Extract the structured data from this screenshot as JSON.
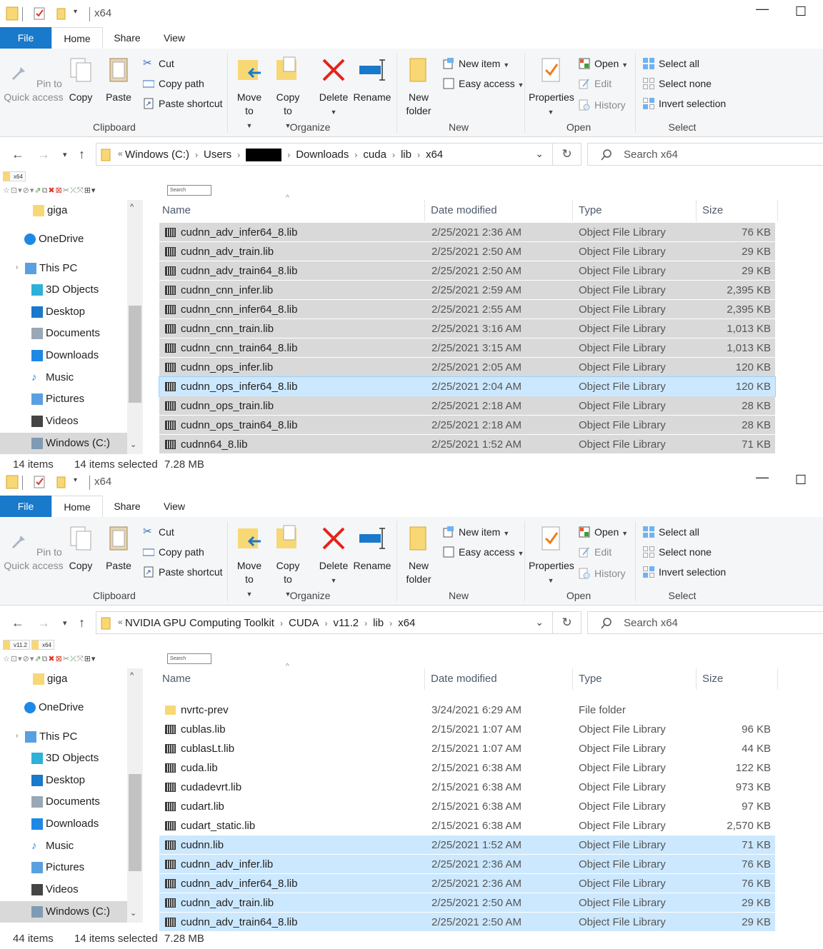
{
  "windows": [
    {
      "title": "x64",
      "tabs": [
        "File",
        "Home",
        "Share",
        "View"
      ],
      "ribbon": {
        "clipboard": {
          "label": "Clipboard",
          "pin": "Pin to Quick access",
          "copy": "Copy",
          "paste": "Paste",
          "cut": "Cut",
          "copy_path": "Copy path",
          "paste_shortcut": "Paste shortcut"
        },
        "organize": {
          "label": "Organize",
          "move_to": "Move to",
          "copy_to": "Copy to",
          "delete": "Delete",
          "rename": "Rename"
        },
        "new": {
          "label": "New",
          "new_folder": "New folder",
          "new_item": "New item",
          "easy_access": "Easy access"
        },
        "open": {
          "label": "Open",
          "properties": "Properties",
          "open": "Open",
          "edit": "Edit",
          "history": "History"
        },
        "select": {
          "label": "Select",
          "select_all": "Select all",
          "select_none": "Select none",
          "invert": "Invert selection"
        }
      },
      "address": {
        "prefix": "«",
        "crumbs": [
          "Windows (C:)",
          "Users",
          "",
          "Downloads",
          "cuda",
          "lib",
          "x64"
        ],
        "redacted_index": 2
      },
      "search_placeholder": "Search x64",
      "mini_tabs": [
        "x64"
      ],
      "mini_search": "Search",
      "nav": [
        "giga",
        "OneDrive",
        "This PC",
        "3D Objects",
        "Desktop",
        "Documents",
        "Downloads",
        "Music",
        "Pictures",
        "Videos",
        "Windows (C:)"
      ],
      "columns": [
        "Name",
        "Date modified",
        "Type",
        "Size"
      ],
      "files": [
        {
          "name": "cudnn_adv_infer64_8.lib",
          "date": "2/25/2021 2:36 AM",
          "type": "Object File Library",
          "size": "76 KB",
          "state": "gray"
        },
        {
          "name": "cudnn_adv_train.lib",
          "date": "2/25/2021 2:50 AM",
          "type": "Object File Library",
          "size": "29 KB",
          "state": "gray"
        },
        {
          "name": "cudnn_adv_train64_8.lib",
          "date": "2/25/2021 2:50 AM",
          "type": "Object File Library",
          "size": "29 KB",
          "state": "gray"
        },
        {
          "name": "cudnn_cnn_infer.lib",
          "date": "2/25/2021 2:59 AM",
          "type": "Object File Library",
          "size": "2,395 KB",
          "state": "gray"
        },
        {
          "name": "cudnn_cnn_infer64_8.lib",
          "date": "2/25/2021 2:55 AM",
          "type": "Object File Library",
          "size": "2,395 KB",
          "state": "gray"
        },
        {
          "name": "cudnn_cnn_train.lib",
          "date": "2/25/2021 3:16 AM",
          "type": "Object File Library",
          "size": "1,013 KB",
          "state": "gray"
        },
        {
          "name": "cudnn_cnn_train64_8.lib",
          "date": "2/25/2021 3:15 AM",
          "type": "Object File Library",
          "size": "1,013 KB",
          "state": "gray"
        },
        {
          "name": "cudnn_ops_infer.lib",
          "date": "2/25/2021 2:05 AM",
          "type": "Object File Library",
          "size": "120 KB",
          "state": "gray"
        },
        {
          "name": "cudnn_ops_infer64_8.lib",
          "date": "2/25/2021 2:04 AM",
          "type": "Object File Library",
          "size": "120 KB",
          "state": "focus"
        },
        {
          "name": "cudnn_ops_train.lib",
          "date": "2/25/2021 2:18 AM",
          "type": "Object File Library",
          "size": "28 KB",
          "state": "gray"
        },
        {
          "name": "cudnn_ops_train64_8.lib",
          "date": "2/25/2021 2:18 AM",
          "type": "Object File Library",
          "size": "28 KB",
          "state": "gray"
        },
        {
          "name": "cudnn64_8.lib",
          "date": "2/25/2021 1:52 AM",
          "type": "Object File Library",
          "size": "71 KB",
          "state": "gray"
        }
      ],
      "status": {
        "count": "14 items",
        "selected": "14 items selected",
        "size": "7.28 MB"
      }
    },
    {
      "title": "x64",
      "tabs": [
        "File",
        "Home",
        "Share",
        "View"
      ],
      "ribbon": {
        "clipboard": {
          "label": "Clipboard",
          "pin": "Pin to Quick access",
          "copy": "Copy",
          "paste": "Paste",
          "cut": "Cut",
          "copy_path": "Copy path",
          "paste_shortcut": "Paste shortcut"
        },
        "organize": {
          "label": "Organize",
          "move_to": "Move to",
          "copy_to": "Copy to",
          "delete": "Delete",
          "rename": "Rename"
        },
        "new": {
          "label": "New",
          "new_folder": "New folder",
          "new_item": "New item",
          "easy_access": "Easy access"
        },
        "open": {
          "label": "Open",
          "properties": "Properties",
          "open": "Open",
          "edit": "Edit",
          "history": "History"
        },
        "select": {
          "label": "Select",
          "select_all": "Select all",
          "select_none": "Select none",
          "invert": "Invert selection"
        }
      },
      "address": {
        "prefix": "«",
        "crumbs": [
          "NVIDIA GPU Computing Toolkit",
          "CUDA",
          "v11.2",
          "lib",
          "x64"
        ],
        "redacted_index": -1
      },
      "search_placeholder": "Search x64",
      "mini_tabs": [
        "v11.2",
        "x64"
      ],
      "mini_search": "Search",
      "nav": [
        "giga",
        "OneDrive",
        "This PC",
        "3D Objects",
        "Desktop",
        "Documents",
        "Downloads",
        "Music",
        "Pictures",
        "Videos",
        "Windows (C:)"
      ],
      "columns": [
        "Name",
        "Date modified",
        "Type",
        "Size"
      ],
      "files": [
        {
          "name": "nvrtc-prev",
          "date": "3/24/2021 6:29 AM",
          "type": "File folder",
          "size": "",
          "state": "none",
          "folder": true
        },
        {
          "name": "cublas.lib",
          "date": "2/15/2021 1:07 AM",
          "type": "Object File Library",
          "size": "96 KB",
          "state": "none"
        },
        {
          "name": "cublasLt.lib",
          "date": "2/15/2021 1:07 AM",
          "type": "Object File Library",
          "size": "44 KB",
          "state": "none"
        },
        {
          "name": "cuda.lib",
          "date": "2/15/2021 6:38 AM",
          "type": "Object File Library",
          "size": "122 KB",
          "state": "none"
        },
        {
          "name": "cudadevrt.lib",
          "date": "2/15/2021 6:38 AM",
          "type": "Object File Library",
          "size": "973 KB",
          "state": "none"
        },
        {
          "name": "cudart.lib",
          "date": "2/15/2021 6:38 AM",
          "type": "Object File Library",
          "size": "97 KB",
          "state": "none"
        },
        {
          "name": "cudart_static.lib",
          "date": "2/15/2021 6:38 AM",
          "type": "Object File Library",
          "size": "2,570 KB",
          "state": "none"
        },
        {
          "name": "cudnn.lib",
          "date": "2/25/2021 1:52 AM",
          "type": "Object File Library",
          "size": "71 KB",
          "state": "blue"
        },
        {
          "name": "cudnn_adv_infer.lib",
          "date": "2/25/2021 2:36 AM",
          "type": "Object File Library",
          "size": "76 KB",
          "state": "blue"
        },
        {
          "name": "cudnn_adv_infer64_8.lib",
          "date": "2/25/2021 2:36 AM",
          "type": "Object File Library",
          "size": "76 KB",
          "state": "blue"
        },
        {
          "name": "cudnn_adv_train.lib",
          "date": "2/25/2021 2:50 AM",
          "type": "Object File Library",
          "size": "29 KB",
          "state": "blue"
        },
        {
          "name": "cudnn_adv_train64_8.lib",
          "date": "2/25/2021 2:50 AM",
          "type": "Object File Library",
          "size": "29 KB",
          "state": "blue"
        }
      ],
      "status": {
        "count": "44 items",
        "selected": "14 items selected",
        "size": "7.28 MB"
      }
    }
  ],
  "colors": {
    "accent": "#1979ca",
    "selected_blue": "#cce8ff",
    "selected_gray": "#d9d9d9",
    "folder": "#f8d775"
  },
  "icons": {
    "minimize": "minimize-icon",
    "maximize": "maximize-icon",
    "back": "back-arrow-icon",
    "forward": "forward-arrow-icon",
    "up": "up-arrow-icon",
    "refresh": "refresh-icon",
    "search": "search-icon"
  }
}
